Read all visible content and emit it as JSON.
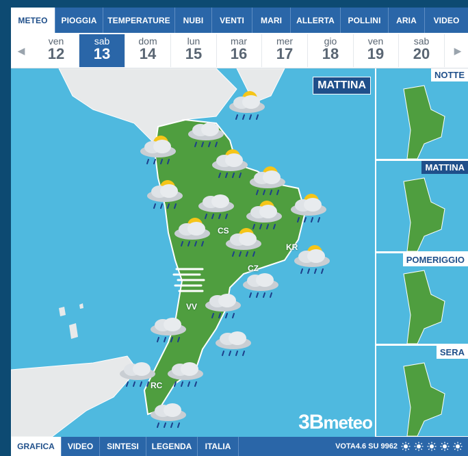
{
  "top_tabs": [
    "METEO",
    "PIOGGIA",
    "TEMPERATURE",
    "NUBI",
    "VENTI",
    "MARI",
    "ALLERTA",
    "POLLINI",
    "ARIA",
    "VIDEO"
  ],
  "days": [
    {
      "name": "ven",
      "num": "12"
    },
    {
      "name": "sab",
      "num": "13"
    },
    {
      "name": "dom",
      "num": "14"
    },
    {
      "name": "lun",
      "num": "15"
    },
    {
      "name": "mar",
      "num": "16"
    },
    {
      "name": "mer",
      "num": "17"
    },
    {
      "name": "gio",
      "num": "18"
    },
    {
      "name": "ven",
      "num": "19"
    },
    {
      "name": "sab",
      "num": "20"
    }
  ],
  "map": {
    "period": "MATTINA",
    "cities": [
      "CS",
      "KR",
      "CZ",
      "VV",
      "RC"
    ],
    "logo_prefix": "3B",
    "logo_text": "meteo"
  },
  "thumbs": [
    "NOTTE",
    "MATTINA",
    "POMERIGGIO",
    "SERA"
  ],
  "bottom_tabs": [
    "GRAFICA",
    "VIDEO",
    "SINTESI",
    "LEGENDA",
    "ITALIA"
  ],
  "vote": {
    "label": "VOTA",
    "score": "4.6",
    "sep": "SU",
    "count": "9962"
  },
  "colors": {
    "accent": "#2a66a8",
    "sea": "#4fb9df",
    "land": "#4f9e3f",
    "sun": "#f5c518"
  }
}
